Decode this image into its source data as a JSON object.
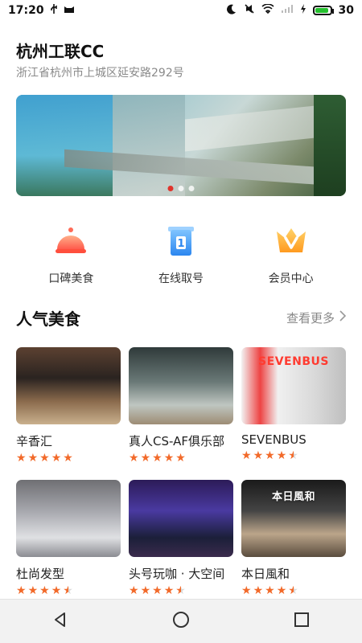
{
  "status_bar": {
    "time": "17:20",
    "battery": "30"
  },
  "venue": {
    "title": "杭州工联CC",
    "address": "浙江省杭州市上城区延安路292号"
  },
  "banner": {
    "active_index": 0,
    "dot_count": 3
  },
  "quick_actions": [
    {
      "label": "口碑美食",
      "icon": "food-cloche-icon"
    },
    {
      "label": "在线取号",
      "icon": "queue-ticket-icon"
    },
    {
      "label": "会员中心",
      "icon": "vip-crown-icon"
    }
  ],
  "section": {
    "title": "人气美食",
    "more": "查看更多"
  },
  "cards": [
    {
      "name": "辛香汇",
      "rating": 5,
      "overlay": ""
    },
    {
      "name": "真人CS-AF俱乐部",
      "rating": 5,
      "overlay": ""
    },
    {
      "name": "SEVENBUS",
      "rating": 4.5,
      "overlay": "SEVENBUS"
    },
    {
      "name": "杜尚发型",
      "rating": 4.5,
      "overlay": ""
    },
    {
      "name": "头号玩咖 · 大空间",
      "rating": 4.5,
      "overlay": ""
    },
    {
      "name": "本日風和",
      "rating": 4.5,
      "overlay": "本日風和"
    }
  ],
  "colors": {
    "accent": "#f26a2a",
    "active_dot": "#e0332b"
  }
}
